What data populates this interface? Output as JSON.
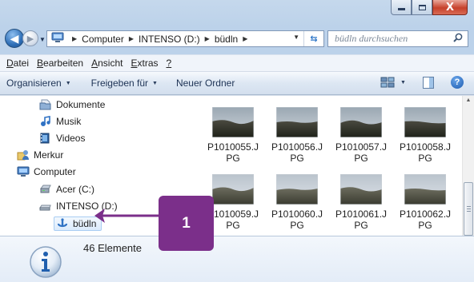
{
  "window": {
    "caption_buttons": [
      "minimize-icon",
      "maximize-icon",
      "close-icon"
    ],
    "close_glyph": "X"
  },
  "nav": {
    "address_crumbs": [
      "Computer",
      "INTENSO (D:)",
      "büdln"
    ],
    "search_placeholder": "büdln durchsuchen"
  },
  "menubar": {
    "items": [
      {
        "u": "D",
        "rest": "atei"
      },
      {
        "u": "B",
        "rest": "earbeiten"
      },
      {
        "u": "A",
        "rest": "nsicht"
      },
      {
        "u": "E",
        "rest": "xtras"
      },
      {
        "u": "?",
        "rest": ""
      }
    ]
  },
  "toolbar": {
    "organize": "Organisieren",
    "share": "Freigeben für",
    "new_folder": "Neuer Ordner",
    "help": "?"
  },
  "tree": {
    "items": [
      {
        "label": "Dokumente",
        "icon": "documents-icon"
      },
      {
        "label": "Musik",
        "icon": "music-icon"
      },
      {
        "label": "Videos",
        "icon": "videos-icon"
      },
      {
        "label": "Merkur",
        "icon": "user-icon"
      },
      {
        "label": "Computer",
        "icon": "computer-icon"
      },
      {
        "label": "Acer (C:)",
        "icon": "drive-icon"
      },
      {
        "label": "INTENSO (D:)",
        "icon": "removable-drive-icon"
      },
      {
        "label": "büdln",
        "icon": "folder-icon",
        "selected": true
      }
    ]
  },
  "files": [
    {
      "line1": "P1010055.J",
      "line2": "PG"
    },
    {
      "line1": "P1010056.J",
      "line2": "PG"
    },
    {
      "line1": "P1010057.J",
      "line2": "PG"
    },
    {
      "line1": "P1010058.J",
      "line2": "PG"
    },
    {
      "line1": "P1010059.J",
      "line2": "PG"
    },
    {
      "line1": "P1010060.J",
      "line2": "PG"
    },
    {
      "line1": "P1010061.J",
      "line2": "PG"
    },
    {
      "line1": "P1010062.J",
      "line2": "PG"
    }
  ],
  "details": {
    "item_count": "46 Elemente"
  },
  "annotation": {
    "label": "1",
    "color": "#7b2f8a"
  }
}
